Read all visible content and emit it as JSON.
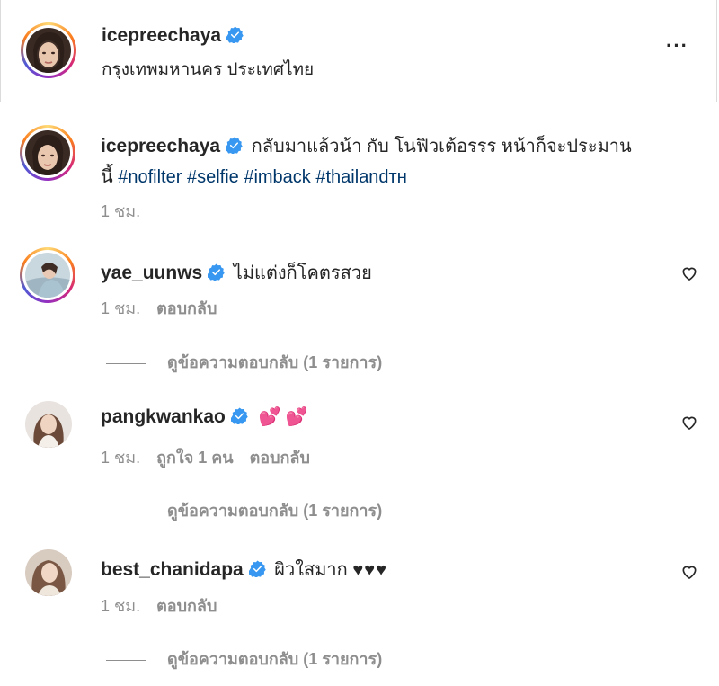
{
  "post_header": {
    "username": "icepreechaya",
    "location": "กรุงเทพมหานคร ประเทศไทย",
    "more_label": "···"
  },
  "caption": {
    "username": "icepreechaya",
    "text": "กลับมาแล้วน้า กับ โนฟิวเต้อรรร หน้าก็จะประมาน",
    "text_line2": "นี้",
    "hashtags": [
      "#nofilter",
      "#selfie",
      "#imback",
      "#thailandᴛʜ"
    ],
    "time": "1 ชม."
  },
  "comments": [
    {
      "username": "yae_uunws",
      "text": "ไม่แต่งก็โคตรสวย",
      "time": "1 ชม.",
      "likes": "",
      "reply_label": "ตอบกลับ",
      "view_replies": "ดูข้อความตอบกลับ (1 รายการ)"
    },
    {
      "username": "pangkwankao",
      "text": "💕 💕",
      "time": "1 ชม.",
      "likes": "ถูกใจ 1 คน",
      "reply_label": "ตอบกลับ",
      "view_replies": "ดูข้อความตอบกลับ (1 รายการ)"
    },
    {
      "username": "best_chanidapa",
      "text": "ผิวใสมาก",
      "hearts": "♥♥♥",
      "time": "1 ชม.",
      "likes": "",
      "reply_label": "ตอบกลับ",
      "view_replies": "ดูข้อความตอบกลับ (1 รายการ)"
    }
  ],
  "icons": {
    "verified": "verified-badge-icon",
    "heart": "heart-outline-icon",
    "more": "more-options-icon"
  },
  "colors": {
    "verified": "#3897f0",
    "hashtag": "#00376b",
    "secondary_text": "#8e8e8e"
  }
}
